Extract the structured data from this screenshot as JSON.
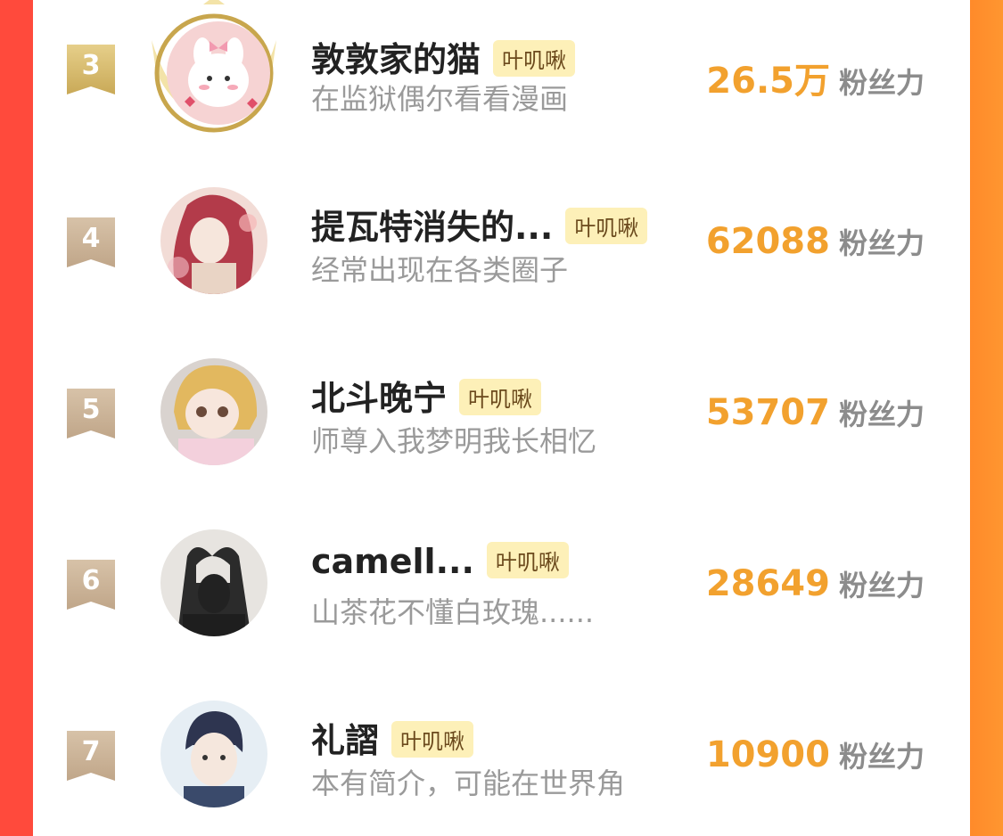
{
  "tag_label": "叶叽啾",
  "fans_suffix": "粉丝力",
  "rows": [
    {
      "rank": "3",
      "name": "敦敦家的猫",
      "bio": "在监狱偶尔看看漫画",
      "fans": "26.5万",
      "avatar": "pink-bunny-avatar",
      "crowned": true
    },
    {
      "rank": "4",
      "name": "提瓦特消失的...",
      "bio": "经常出现在各类圈子",
      "fans": "62088",
      "avatar": "anime-girl-red-hair-avatar"
    },
    {
      "rank": "5",
      "name": "北斗晚宁",
      "bio": "师尊入我梦明我长相忆",
      "fans": "53707",
      "avatar": "blonde-doll-avatar"
    },
    {
      "rank": "6",
      "name": "camell...",
      "bio": "山茶花不懂白玫瑰......",
      "fans": "28649",
      "avatar": "heart-hands-silhouette-avatar"
    },
    {
      "rank": "7",
      "name": "礼謵",
      "bio": "本有简介，可能在世界角",
      "fans": "10900",
      "avatar": "anime-boy-avatar"
    }
  ],
  "colors": {
    "accent_number": "#f2a12e",
    "tag_bg": "#fdf0b8",
    "left_edge": "#ff4a3c",
    "right_edge": "#ff9630"
  }
}
